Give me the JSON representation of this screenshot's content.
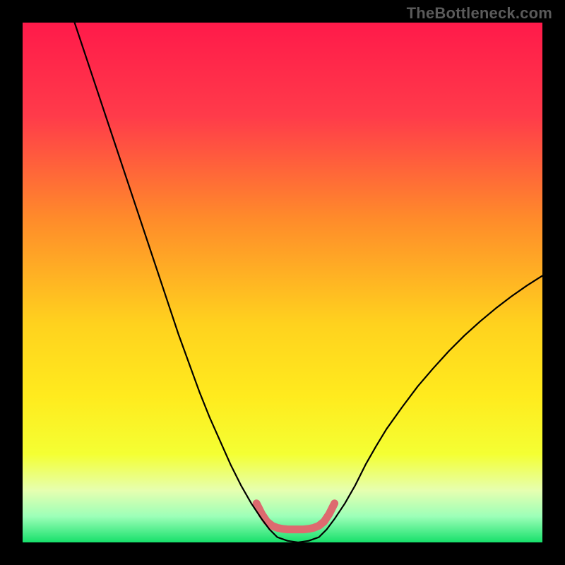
{
  "watermark": "TheBottleneck.com",
  "chart_data": {
    "type": "line",
    "title": "",
    "xlabel": "",
    "ylabel": "",
    "xlim": [
      0,
      100
    ],
    "ylim": [
      0,
      100
    ],
    "grid": false,
    "legend": false,
    "background_gradient": {
      "stops": [
        {
          "offset": 0.0,
          "color": "#ff1a4a"
        },
        {
          "offset": 0.18,
          "color": "#ff3b4a"
        },
        {
          "offset": 0.38,
          "color": "#ff8c2a"
        },
        {
          "offset": 0.58,
          "color": "#ffd21e"
        },
        {
          "offset": 0.72,
          "color": "#ffeb1e"
        },
        {
          "offset": 0.83,
          "color": "#f4ff33"
        },
        {
          "offset": 0.9,
          "color": "#e6ffb0"
        },
        {
          "offset": 0.95,
          "color": "#9cffb8"
        },
        {
          "offset": 1.0,
          "color": "#17e06b"
        }
      ]
    },
    "series": [
      {
        "name": "bottleneck-curve",
        "stroke": "#000000",
        "stroke_width": 2.2,
        "points": [
          {
            "x": 10.0,
            "y": 100.0
          },
          {
            "x": 12.0,
            "y": 94.0
          },
          {
            "x": 14.0,
            "y": 88.0
          },
          {
            "x": 16.0,
            "y": 82.0
          },
          {
            "x": 18.0,
            "y": 76.0
          },
          {
            "x": 20.0,
            "y": 70.0
          },
          {
            "x": 22.0,
            "y": 64.0
          },
          {
            "x": 24.0,
            "y": 58.0
          },
          {
            "x": 26.0,
            "y": 52.0
          },
          {
            "x": 28.0,
            "y": 46.0
          },
          {
            "x": 30.0,
            "y": 40.0
          },
          {
            "x": 32.0,
            "y": 34.5
          },
          {
            "x": 34.0,
            "y": 29.0
          },
          {
            "x": 36.0,
            "y": 24.0
          },
          {
            "x": 38.0,
            "y": 19.5
          },
          {
            "x": 40.0,
            "y": 15.0
          },
          {
            "x": 42.0,
            "y": 11.0
          },
          {
            "x": 44.0,
            "y": 7.5
          },
          {
            "x": 46.0,
            "y": 4.5
          },
          {
            "x": 47.5,
            "y": 2.5
          },
          {
            "x": 49.0,
            "y": 1.0
          },
          {
            "x": 51.0,
            "y": 0.3
          },
          {
            "x": 53.0,
            "y": 0.0
          },
          {
            "x": 55.0,
            "y": 0.3
          },
          {
            "x": 57.0,
            "y": 1.0
          },
          {
            "x": 58.5,
            "y": 2.5
          },
          {
            "x": 60.0,
            "y": 4.5
          },
          {
            "x": 62.0,
            "y": 7.5
          },
          {
            "x": 64.0,
            "y": 11.0
          },
          {
            "x": 66.0,
            "y": 15.0
          },
          {
            "x": 68.0,
            "y": 18.5
          },
          {
            "x": 70.0,
            "y": 21.8
          },
          {
            "x": 73.0,
            "y": 26.0
          },
          {
            "x": 76.0,
            "y": 30.0
          },
          {
            "x": 79.0,
            "y": 33.5
          },
          {
            "x": 82.0,
            "y": 36.8
          },
          {
            "x": 85.0,
            "y": 39.8
          },
          {
            "x": 88.0,
            "y": 42.5
          },
          {
            "x": 91.0,
            "y": 45.0
          },
          {
            "x": 94.0,
            "y": 47.3
          },
          {
            "x": 97.0,
            "y": 49.4
          },
          {
            "x": 100.0,
            "y": 51.3
          }
        ]
      },
      {
        "name": "optimal-region",
        "stroke": "#dd6a6f",
        "stroke_width": 11,
        "linecap": "round",
        "points": [
          {
            "x": 45.0,
            "y": 7.5
          },
          {
            "x": 46.0,
            "y": 5.5
          },
          {
            "x": 47.0,
            "y": 4.0
          },
          {
            "x": 48.0,
            "y": 3.2
          },
          {
            "x": 49.0,
            "y": 2.8
          },
          {
            "x": 50.0,
            "y": 2.6
          },
          {
            "x": 51.0,
            "y": 2.5
          },
          {
            "x": 52.0,
            "y": 2.5
          },
          {
            "x": 53.0,
            "y": 2.5
          },
          {
            "x": 54.0,
            "y": 2.5
          },
          {
            "x": 55.0,
            "y": 2.6
          },
          {
            "x": 56.0,
            "y": 2.8
          },
          {
            "x": 57.0,
            "y": 3.2
          },
          {
            "x": 58.0,
            "y": 4.0
          },
          {
            "x": 59.0,
            "y": 5.5
          },
          {
            "x": 60.0,
            "y": 7.5
          }
        ]
      }
    ]
  }
}
